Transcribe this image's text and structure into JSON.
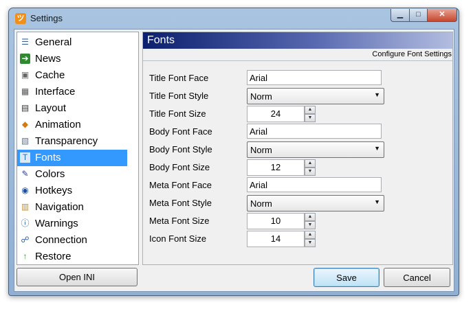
{
  "window": {
    "title": "Settings"
  },
  "titlebar_controls": {
    "minimize": "▁",
    "maximize": "□",
    "close": "✕"
  },
  "sidebar": {
    "items": [
      {
        "label": "General",
        "icon": "general-icon",
        "glyph": "☰",
        "color": "#3a5f8f"
      },
      {
        "label": "News",
        "icon": "news-icon",
        "glyph": "➔",
        "color": "#ffffff"
      },
      {
        "label": "Cache",
        "icon": "cache-icon",
        "glyph": "▣",
        "color": "#666666"
      },
      {
        "label": "Interface",
        "icon": "interface-icon",
        "glyph": "▦",
        "color": "#555555"
      },
      {
        "label": "Layout",
        "icon": "layout-icon",
        "glyph": "▤",
        "color": "#333333"
      },
      {
        "label": "Animation",
        "icon": "animation-icon",
        "glyph": "◆",
        "color": "#d67a10"
      },
      {
        "label": "Transparency",
        "icon": "transparency-icon",
        "glyph": "▧",
        "color": "#667788"
      },
      {
        "label": "Fonts",
        "icon": "fonts-icon",
        "glyph": "T",
        "color": "#2a6fb5"
      },
      {
        "label": "Colors",
        "icon": "colors-icon",
        "glyph": "✎",
        "color": "#1b3fa8"
      },
      {
        "label": "Hotkeys",
        "icon": "hotkeys-icon",
        "glyph": "◉",
        "color": "#1d4f9f"
      },
      {
        "label": "Navigation",
        "icon": "navigation-icon",
        "glyph": "▥",
        "color": "#c0902a"
      },
      {
        "label": "Warnings",
        "icon": "warnings-icon",
        "glyph": "ⓘ",
        "color": "#1a5fb0"
      },
      {
        "label": "Connection",
        "icon": "connection-icon",
        "glyph": "☍",
        "color": "#2b5c9c"
      },
      {
        "label": "Restore",
        "icon": "restore-icon",
        "glyph": "↑",
        "color": "#2f9a2f"
      }
    ],
    "selected_index": 7
  },
  "open_ini_label": "Open INI",
  "content": {
    "title": "Fonts",
    "subtitle": "Configure Font Settings",
    "fields": {
      "title_face": {
        "label": "Title Font Face",
        "value": "Arial"
      },
      "title_style": {
        "label": "Title Font Style",
        "value": "Norm"
      },
      "title_size": {
        "label": "Title Font Size",
        "value": "24"
      },
      "body_face": {
        "label": "Body Font Face",
        "value": "Arial"
      },
      "body_style": {
        "label": "Body Font Style",
        "value": "Norm"
      },
      "body_size": {
        "label": "Body Font Size",
        "value": "12"
      },
      "meta_face": {
        "label": "Meta Font Face",
        "value": "Arial"
      },
      "meta_style": {
        "label": "Meta Font Style",
        "value": "Norm"
      },
      "meta_size": {
        "label": "Meta Font Size",
        "value": "10"
      },
      "icon_size": {
        "label": "Icon Font Size",
        "value": "14"
      }
    }
  },
  "buttons": {
    "save": "Save",
    "cancel": "Cancel"
  }
}
